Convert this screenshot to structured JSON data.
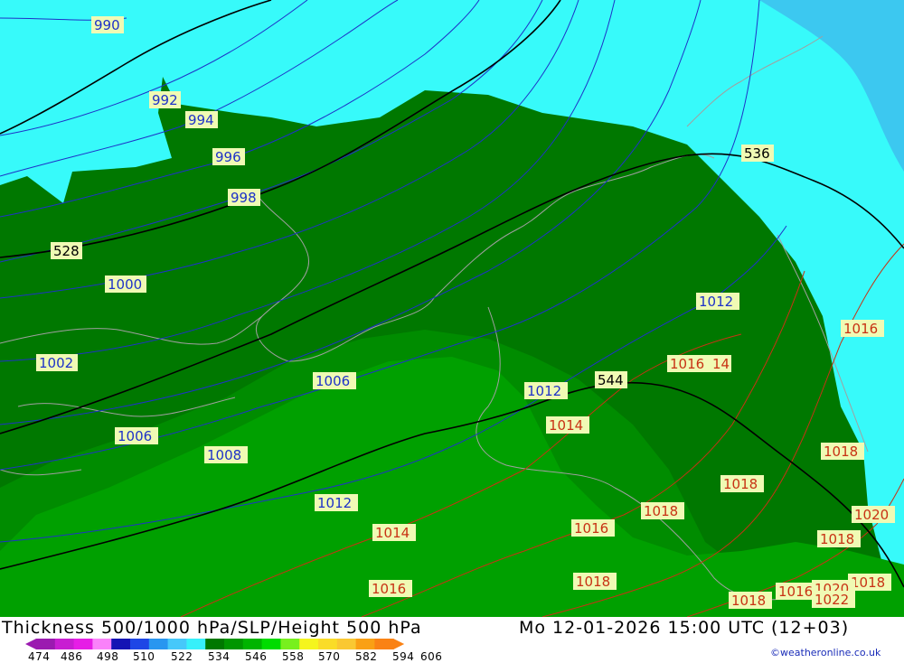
{
  "footer": {
    "title": "Thickness 500/1000 hPa/SLP/Height 500 hPa",
    "time": "Mo 12-01-2026 15:00 UTC (12+03)",
    "credit": "©weatheronline.co.uk"
  },
  "legend": {
    "ticks": [
      "474",
      "486",
      "498",
      "510",
      "522",
      "534",
      "546",
      "558",
      "570",
      "582",
      "594",
      "606"
    ],
    "colors": [
      "#9b1ab0",
      "#c81ed2",
      "#e61ee6",
      "#fa82fa",
      "#1414b4",
      "#1e46e6",
      "#2896f0",
      "#46c8fa",
      "#37f0fa",
      "#007800",
      "#009600",
      "#00b400",
      "#00dc00",
      "#78f01e",
      "#f5f51e",
      "#fadc28",
      "#fac832",
      "#faa014",
      "#fa8214"
    ]
  },
  "map": {
    "colors": {
      "thickness_522_534": "#37fafa",
      "thickness_528_540": "#007800",
      "thickness_540_546": "#008c00",
      "thickness_546_552": "#00a000",
      "sea": "#3cc8f0",
      "slp_low": "#1e32c8",
      "slp_high": "#c83214",
      "height_500": "#000000",
      "label_bg": "#f0fab4"
    },
    "slp_labels": [
      {
        "text": "990",
        "kind": "low"
      },
      {
        "text": "992",
        "kind": "low"
      },
      {
        "text": "994",
        "kind": "low"
      },
      {
        "text": "996",
        "kind": "low"
      },
      {
        "text": "998",
        "kind": "low"
      },
      {
        "text": "1000",
        "kind": "low"
      },
      {
        "text": "1002",
        "kind": "low"
      },
      {
        "text": "1006",
        "kind": "low"
      },
      {
        "text": "1006",
        "kind": "low"
      },
      {
        "text": "1008",
        "kind": "low"
      },
      {
        "text": "1012",
        "kind": "low"
      },
      {
        "text": "1012",
        "kind": "low"
      },
      {
        "text": "1012",
        "kind": "low"
      },
      {
        "text": "1014",
        "kind": "high"
      },
      {
        "text": "1014",
        "kind": "high"
      },
      {
        "text": "1016",
        "kind": "high"
      },
      {
        "text": "1016",
        "kind": "high"
      },
      {
        "text": "1016",
        "kind": "high"
      },
      {
        "text": "1016",
        "kind": "high"
      },
      {
        "text": "1016",
        "kind": "high"
      },
      {
        "text": "14",
        "kind": "high"
      },
      {
        "text": "1018",
        "kind": "high"
      },
      {
        "text": "1018",
        "kind": "high"
      },
      {
        "text": "1018",
        "kind": "high"
      },
      {
        "text": "1018",
        "kind": "high"
      },
      {
        "text": "1018",
        "kind": "high"
      },
      {
        "text": "1018",
        "kind": "high"
      },
      {
        "text": "1018",
        "kind": "high"
      },
      {
        "text": "1020",
        "kind": "high"
      },
      {
        "text": "1020",
        "kind": "high"
      },
      {
        "text": "1022",
        "kind": "high"
      }
    ],
    "height_labels": [
      "528",
      "536",
      "544"
    ]
  }
}
